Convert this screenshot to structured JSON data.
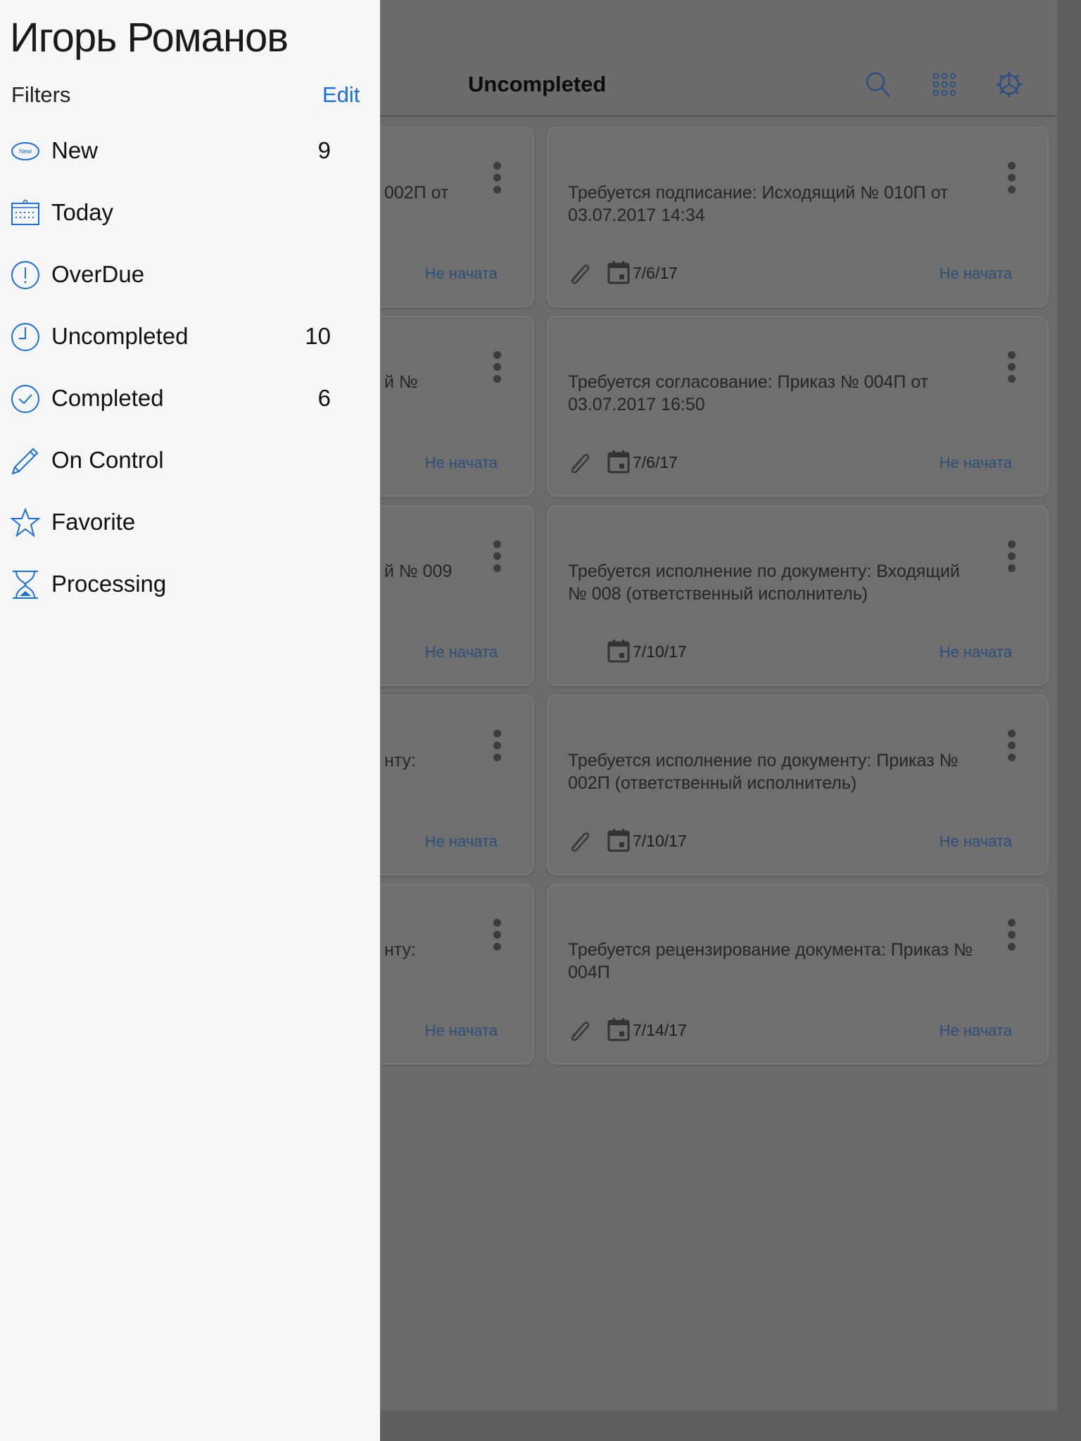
{
  "sidebar": {
    "user_name": "Игорь Романов",
    "filters_label": "Filters",
    "edit_label": "Edit",
    "accent_color": "#1a6fe0",
    "items": [
      {
        "label": "New",
        "count": "9",
        "icon": "new-badge-icon"
      },
      {
        "label": "Today",
        "count": "",
        "icon": "calendar-icon"
      },
      {
        "label": "OverDue",
        "count": "",
        "icon": "exclamation-circle-icon"
      },
      {
        "label": "Uncompleted",
        "count": "10",
        "icon": "clock-icon"
      },
      {
        "label": "Completed",
        "count": "6",
        "icon": "check-circle-icon"
      },
      {
        "label": "On Control",
        "count": "",
        "icon": "pencil-icon"
      },
      {
        "label": "Favorite",
        "count": "",
        "icon": "star-icon"
      },
      {
        "label": "Processing",
        "count": "",
        "icon": "hourglass-icon"
      }
    ],
    "new_icon_text": "New"
  },
  "header": {
    "title": "Uncompleted",
    "icons": [
      "search-icon",
      "grid-icon",
      "gear-icon"
    ]
  },
  "left_cards": [
    {
      "text": "002П от",
      "status": "Не начата"
    },
    {
      "text": "й №",
      "status": "Не начата"
    },
    {
      "text": "й № 009",
      "status": "Не начата"
    },
    {
      "text": "нту:",
      "status": "Не начата"
    },
    {
      "text": "нту:",
      "status": "Не начата"
    }
  ],
  "cards": [
    {
      "text": "Требуется подписание: Исходящий № 010П от 03.07.2017 14:34",
      "date": "7/6/17",
      "status": "Не начата",
      "attachment": true
    },
    {
      "text": "Требуется согласование: Приказ № 004П от 03.07.2017 16:50",
      "date": "7/6/17",
      "status": "Не начата",
      "attachment": true
    },
    {
      "text": "Требуется исполнение по документу: Входящий № 008 (ответственный исполнитель)",
      "date": "7/10/17",
      "status": "Не начата",
      "attachment": false
    },
    {
      "text": "Требуется исполнение по документу: Приказ № 002П (ответственный исполнитель)",
      "date": "7/10/17",
      "status": "Не начата",
      "attachment": true
    },
    {
      "text": "Требуется рецензирование документа: Приказ № 004П",
      "date": "7/14/17",
      "status": "Не начата",
      "attachment": true
    }
  ]
}
